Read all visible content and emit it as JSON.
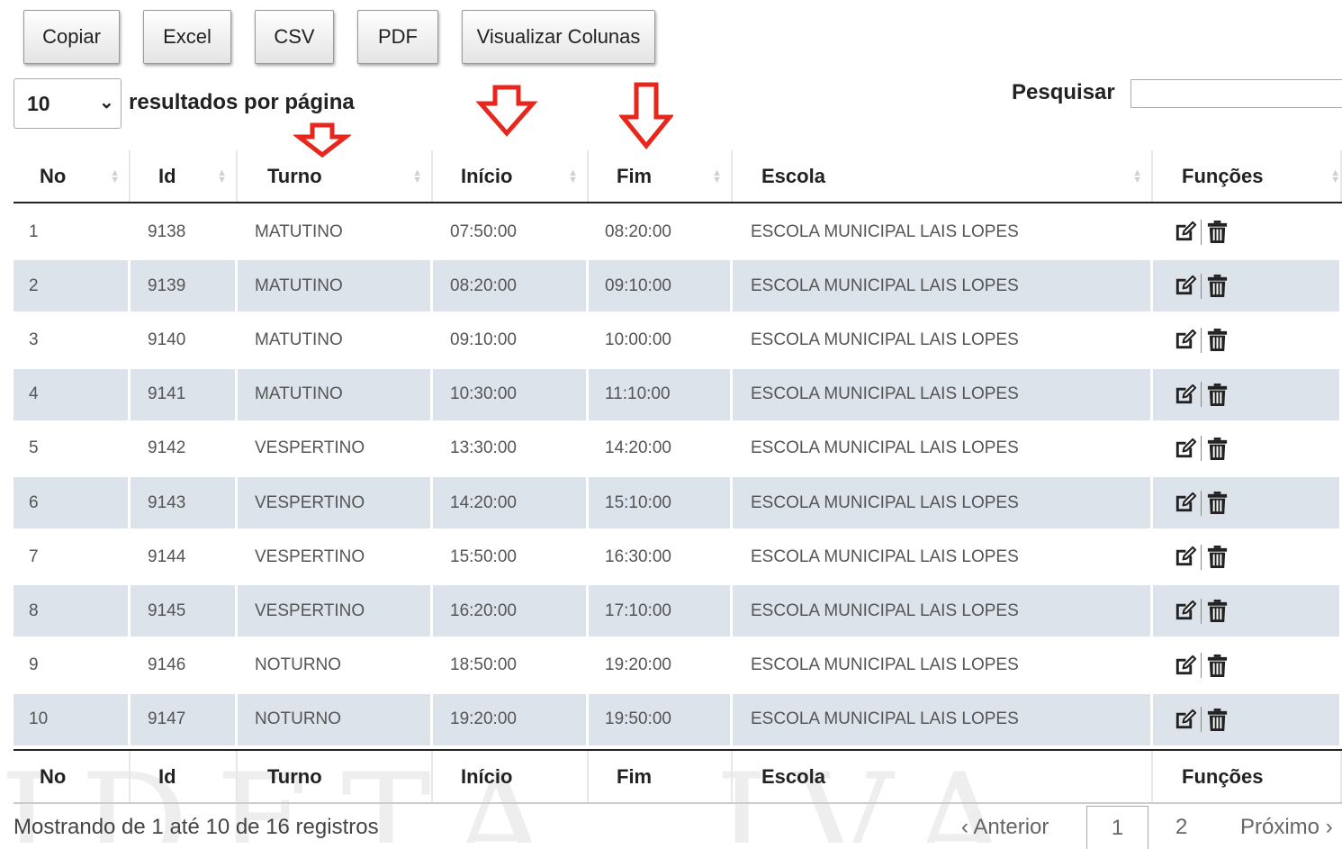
{
  "toolbar": {
    "copy_label": "Copiar",
    "excel_label": "Excel",
    "csv_label": "CSV",
    "pdf_label": "PDF",
    "columns_label": "Visualizar Colunas"
  },
  "length": {
    "value": "10",
    "label": "resultados por página"
  },
  "search": {
    "label": "Pesquisar",
    "value": ""
  },
  "columns": [
    "No",
    "Id",
    "Turno",
    "Início",
    "Fim",
    "Escola",
    "Funções"
  ],
  "rows": [
    {
      "no": "1",
      "id": "9138",
      "turno": "MATUTINO",
      "inicio": "07:50:00",
      "fim": "08:20:00",
      "escola": "ESCOLA MUNICIPAL LAIS LOPES"
    },
    {
      "no": "2",
      "id": "9139",
      "turno": "MATUTINO",
      "inicio": "08:20:00",
      "fim": "09:10:00",
      "escola": "ESCOLA MUNICIPAL LAIS LOPES"
    },
    {
      "no": "3",
      "id": "9140",
      "turno": "MATUTINO",
      "inicio": "09:10:00",
      "fim": "10:00:00",
      "escola": "ESCOLA MUNICIPAL LAIS LOPES"
    },
    {
      "no": "4",
      "id": "9141",
      "turno": "MATUTINO",
      "inicio": "10:30:00",
      "fim": "11:10:00",
      "escola": "ESCOLA MUNICIPAL LAIS LOPES"
    },
    {
      "no": "5",
      "id": "9142",
      "turno": "VESPERTINO",
      "inicio": "13:30:00",
      "fim": "14:20:00",
      "escola": "ESCOLA MUNICIPAL LAIS LOPES"
    },
    {
      "no": "6",
      "id": "9143",
      "turno": "VESPERTINO",
      "inicio": "14:20:00",
      "fim": "15:10:00",
      "escola": "ESCOLA MUNICIPAL LAIS LOPES"
    },
    {
      "no": "7",
      "id": "9144",
      "turno": "VESPERTINO",
      "inicio": "15:50:00",
      "fim": "16:30:00",
      "escola": "ESCOLA MUNICIPAL LAIS LOPES"
    },
    {
      "no": "8",
      "id": "9145",
      "turno": "VESPERTINO",
      "inicio": "16:20:00",
      "fim": "17:10:00",
      "escola": "ESCOLA MUNICIPAL LAIS LOPES"
    },
    {
      "no": "9",
      "id": "9146",
      "turno": "NOTURNO",
      "inicio": "18:50:00",
      "fim": "19:20:00",
      "escola": "ESCOLA MUNICIPAL LAIS LOPES"
    },
    {
      "no": "10",
      "id": "9147",
      "turno": "NOTURNO",
      "inicio": "19:20:00",
      "fim": "19:50:00",
      "escola": "ESCOLA MUNICIPAL LAIS LOPES"
    }
  ],
  "row_actions": [
    "edit-icon",
    "trash-icon"
  ],
  "info": "Mostrando de 1 até 10 de 16 registros",
  "pagination": {
    "prev": "‹ Anterior",
    "pages": [
      "1",
      "2"
    ],
    "current": "1",
    "next": "Próximo ›"
  },
  "colors": {
    "stripe": "#dde3ea",
    "annotation_arrow": "#e8261b"
  }
}
